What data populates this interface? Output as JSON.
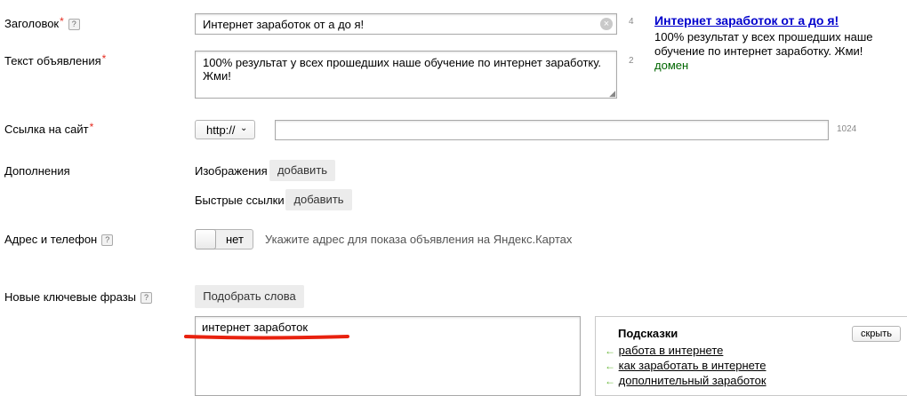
{
  "form": {
    "title": {
      "label": "Заголовок",
      "required_mark": "*",
      "help_glyph": "?",
      "value": "Интернет заработок от а до я!",
      "counter": "4",
      "clear_icon": "close-circle-icon"
    },
    "text": {
      "label": "Текст объявления",
      "required_mark": "*",
      "value": "100% результат у всех прошедших наше обучение по интернет заработку. Жми!",
      "counter": "2"
    },
    "link": {
      "label": "Ссылка на сайт",
      "required_mark": "*",
      "protocol": "http://",
      "value": "",
      "counter": "1024"
    },
    "extras": {
      "label": "Дополнения",
      "images_label": "Изображения",
      "images_button": "добавить",
      "sitelinks_label": "Быстрые ссылки",
      "sitelinks_button": "добавить"
    },
    "address": {
      "label": "Адрес и телефон",
      "help_glyph": "?",
      "toggle_state": "нет",
      "hint": "Укажите адрес для показа объявления на Яндекс.Картах"
    },
    "keywords": {
      "label": "Новые ключевые фразы",
      "help_glyph": "?",
      "pick_button": "Подобрать слова",
      "value": "интернет заработок",
      "underline_color": "#e8210e"
    }
  },
  "preview": {
    "title": "Интернет заработок от а до я!",
    "body": "100% результат у всех прошедших наше обучение по интернет заработку. Жми!",
    "domain": "домен",
    "title_color": "#0000cc",
    "domain_color": "#006600"
  },
  "hints": {
    "title": "Подсказки",
    "hide_button": "скрыть",
    "items": [
      {
        "text": "работа в интернете"
      },
      {
        "text": "как заработать в интернете"
      },
      {
        "text": "дополнительный заработок"
      }
    ]
  }
}
